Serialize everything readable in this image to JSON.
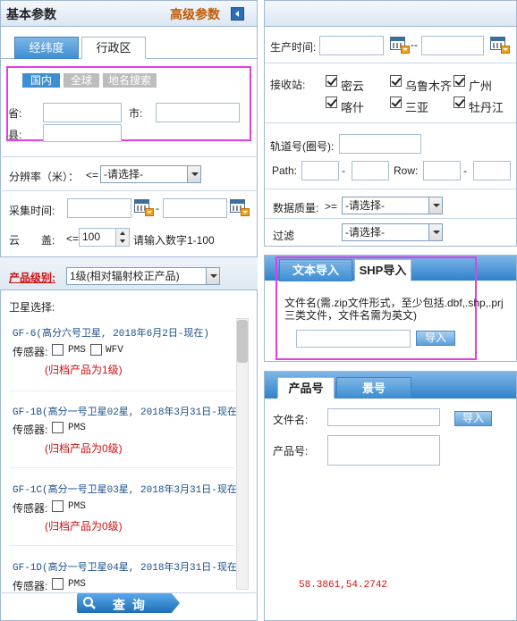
{
  "left": {
    "header": {
      "title": "基本参数",
      "advanced": "高级参数"
    },
    "tabs": [
      "经纬度",
      "行政区"
    ],
    "region_tabs": [
      "国内",
      "全球",
      "地名搜索"
    ],
    "province_label": "省:",
    "city_label": "市:",
    "county_label": "县:",
    "resolution": {
      "label": "分辨率（米）：",
      "op": "<=",
      "value": "-请选择-"
    },
    "capture_time": {
      "label": "采集时间:",
      "dash": "-"
    },
    "cloud": {
      "label": "云　　盖:",
      "op": "<=",
      "value": "100",
      "hint": "请输入数字1-100"
    },
    "product_level": {
      "label": "产品级别:",
      "value": "1级(相对辐射校正产品)"
    },
    "satellite_title": "卫星选择:",
    "satellites": [
      {
        "name": "GF-6(高分六号卫星, 2018年6月2日-现在)",
        "sensor_label": "传感器:",
        "sensors": [
          "PMS",
          "WFV"
        ],
        "note": "(归档产品为1级)"
      },
      {
        "name": "GF-1B(高分一号卫星02星, 2018年3月31日-现在",
        "sensor_label": "传感器:",
        "sensors": [
          "PMS"
        ],
        "note": "(归档产品为0级)"
      },
      {
        "name": "GF-1C(高分一号卫星03星, 2018年3月31日-现在",
        "sensor_label": "传感器:",
        "sensors": [
          "PMS"
        ],
        "note": "(归档产品为0级)"
      },
      {
        "name": "GF-1D(高分一号卫星04星, 2018年3月31日-现在",
        "sensor_label": "传感器:",
        "sensors": [
          "PMS"
        ],
        "note": ""
      }
    ],
    "query_button": "查 询"
  },
  "right": {
    "production_time": {
      "label": "生产时间:",
      "dash": "--"
    },
    "stations": {
      "label": "接收站:",
      "items": [
        {
          "name": "密云",
          "checked": true
        },
        {
          "name": "乌鲁木齐",
          "checked": true
        },
        {
          "name": "广州",
          "checked": true
        },
        {
          "name": "喀什",
          "checked": true
        },
        {
          "name": "三亚",
          "checked": true
        },
        {
          "name": "牡丹江",
          "checked": true
        }
      ]
    },
    "orbit": {
      "label": "轨道号(圈号):",
      "path_label": "Path:",
      "row_label": "Row:",
      "dash": "-"
    },
    "quality": {
      "label": "数据质量:",
      "op": ">=",
      "value": "-请选择-"
    },
    "filter": {
      "label": "过滤",
      "value": "-请选择-"
    },
    "import_tabs": [
      "文本导入",
      "SHP导入"
    ],
    "shp_note": "文件名(需.zip文件形式，至少包括.dbf,.shp,.prj三类文件，文件名需为英文)",
    "import_button": "导入",
    "product_tabs": [
      "产品号",
      "景号"
    ],
    "file_label": "文件名:",
    "product_label": "产品号:",
    "coords": "58.3861,54.2742"
  },
  "colors": {
    "accent": "#1f6fb8",
    "highlight": "#e23fe2",
    "advanced": "#c05a00",
    "alert": "#d01010"
  }
}
